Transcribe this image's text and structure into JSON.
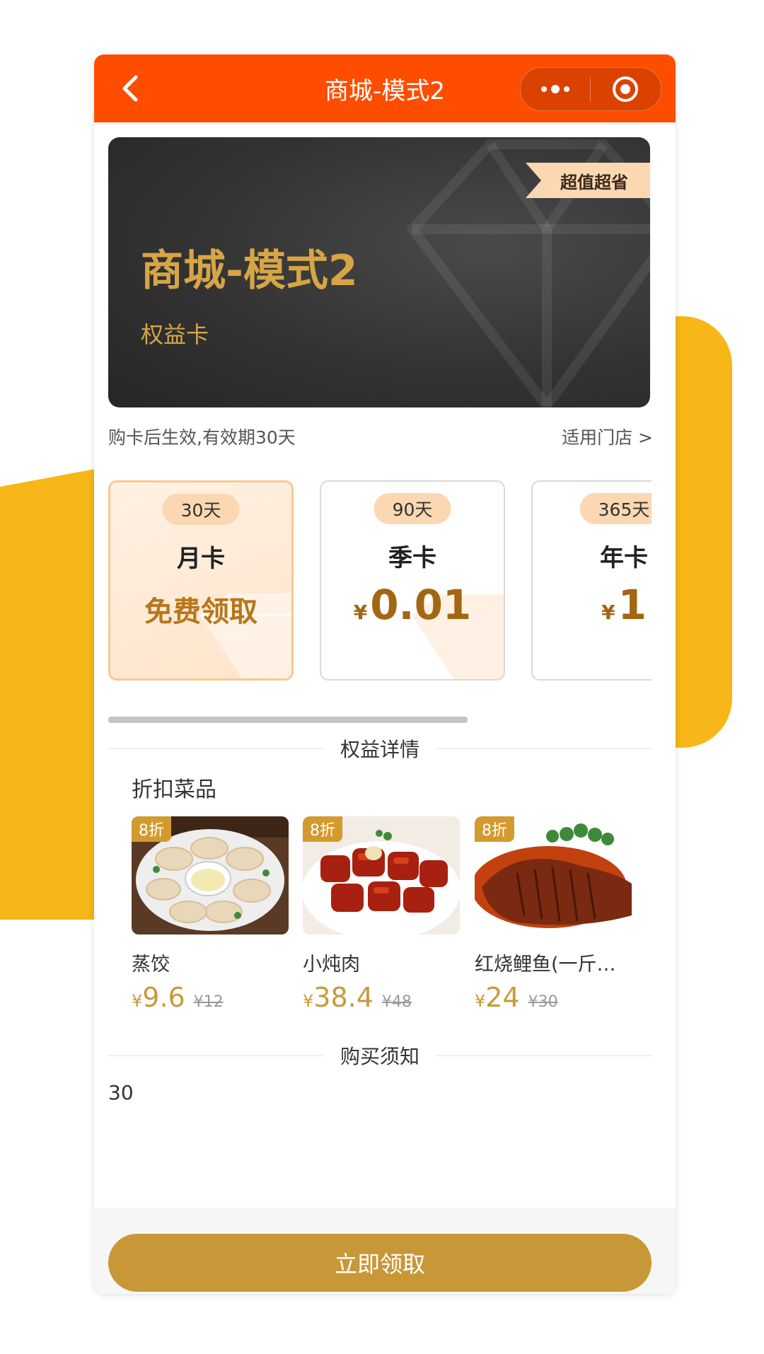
{
  "header": {
    "title": "商城-模式2",
    "back_icon": "chevron-left-icon",
    "more_icon": "more-dots-icon",
    "close_icon": "target-circle-icon"
  },
  "banner": {
    "badge": "超值超省",
    "title": "商城-模式2",
    "subtitle": "权益卡"
  },
  "info": {
    "validity": "购卡后生效,有效期30天",
    "stores_link": "适用门店 >"
  },
  "plans": [
    {
      "days": "30天",
      "name": "月卡",
      "price_label": "免费领取",
      "selected": true
    },
    {
      "days": "90天",
      "name": "季卡",
      "currency": "¥",
      "price": "0.01",
      "selected": false
    },
    {
      "days": "365天",
      "name": "年卡",
      "currency": "¥",
      "price": "1",
      "selected": false
    }
  ],
  "benefits": {
    "section_title": "权益详情",
    "subsection_title": "折扣菜品",
    "dishes": [
      {
        "tag": "8折",
        "name": "蒸饺",
        "currency": "¥",
        "price": "9.6",
        "original": "¥12"
      },
      {
        "tag": "8折",
        "name": "小炖肉",
        "currency": "¥",
        "price": "38.4",
        "original": "¥48"
      },
      {
        "tag": "8折",
        "name": "红烧鲤鱼(一斤…",
        "currency": "¥",
        "price": "24",
        "original": "¥30"
      }
    ]
  },
  "notice": {
    "section_title": "购买须知",
    "text": "30"
  },
  "cta": {
    "label": "立即领取"
  },
  "colors": {
    "nav": "#ff4d00",
    "accent_gold": "#c89838",
    "background_shape": "#f7b718"
  }
}
